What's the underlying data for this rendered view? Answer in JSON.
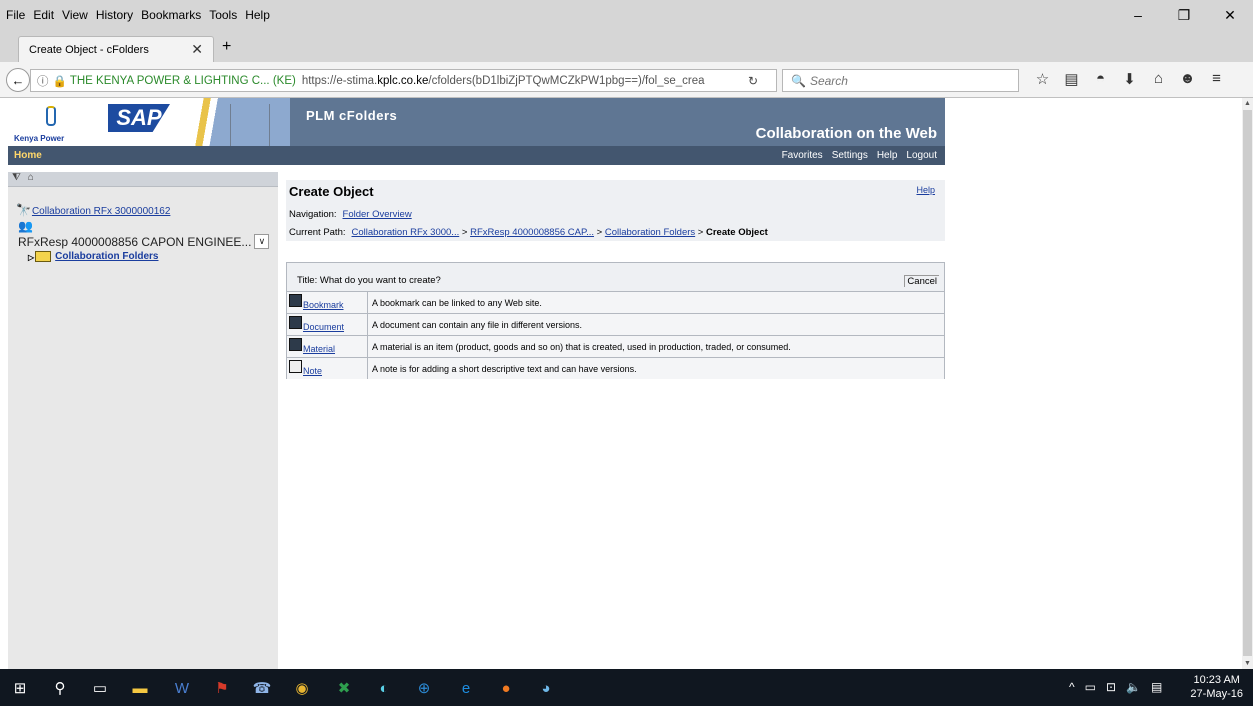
{
  "browser": {
    "menu": [
      "File",
      "Edit",
      "View",
      "History",
      "Bookmarks",
      "Tools",
      "Help"
    ],
    "tab_title": "Create Object - cFolders",
    "site_identity": "THE KENYA POWER & LIGHTING C... (KE)",
    "url_prefix": "https://e-stima.",
    "url_domain": "kplc.co.ke",
    "url_rest": "/cfolders(bD1lbiZjPTQwMCZkPW1pbg==)/fol_se_crea",
    "search_placeholder": "Search"
  },
  "header": {
    "kenya_power": "Kenya Power",
    "sap": "SAP",
    "product": "PLM cFolders",
    "tagline": "Collaboration on the Web",
    "home": "Home",
    "links": [
      "Favorites",
      "Settings",
      "Help",
      "Logout"
    ]
  },
  "left_panel": {
    "collaboration": "Collaboration RFx 3000000162",
    "rfx": "RFxResp 4000008856 CAPON ENGINEE...",
    "folder": "Collaboration Folders"
  },
  "content": {
    "title": "Create Object",
    "help": "Help",
    "nav_label": "Navigation:",
    "nav_link": "Folder Overview",
    "path_label": "Current Path:",
    "path": [
      "Collaboration RFx 3000...",
      "RFxResp 4000008856 CAP...",
      "Collaboration Folders",
      "Create Object"
    ],
    "path_sep": ">"
  },
  "create_table": {
    "title": "Title: What do you want to create?",
    "cancel": "Cancel",
    "rows": [
      {
        "type": "Bookmark",
        "desc": "A bookmark can be linked to any Web site."
      },
      {
        "type": "Document",
        "desc": "A document can contain any file in different versions."
      },
      {
        "type": "Material",
        "desc": "A material is an item (product, goods and so on) that is created, used in production, traded, or consumed."
      },
      {
        "type": "Note",
        "desc": "A note is for adding a short descriptive text and can have versions."
      }
    ]
  },
  "taskbar": {
    "time": "10:23 AM",
    "date": "27-May-16"
  }
}
